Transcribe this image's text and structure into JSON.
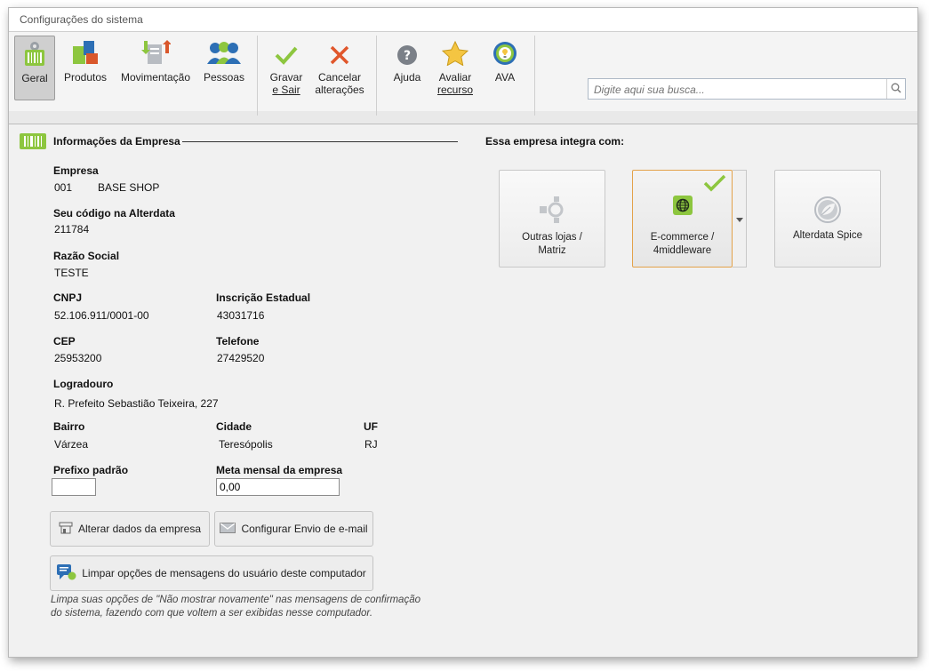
{
  "window": {
    "title": "Configurações do sistema"
  },
  "ribbon": {
    "buttons": [
      {
        "label": "Geral",
        "icon": "barcode-gear-icon",
        "active": true
      },
      {
        "label": "Produtos",
        "icon": "products-icon"
      },
      {
        "label": "Movimentação",
        "icon": "movement-icon"
      },
      {
        "label": "Pessoas",
        "icon": "people-icon"
      },
      {
        "label_line1": "Gravar",
        "label_line2": "e Sair",
        "icon": "check-icon"
      },
      {
        "label_line1": "Cancelar",
        "label_line2": "alterações",
        "icon": "x-icon"
      },
      {
        "label": "Ajuda",
        "icon": "help-icon"
      },
      {
        "label_line1": "Avaliar",
        "label_line2": "recurso",
        "icon": "star-icon"
      },
      {
        "label": "AVA",
        "icon": "ava-icon"
      }
    ],
    "search": {
      "placeholder": "Digite aqui sua busca..."
    }
  },
  "company": {
    "section_title": "Informações da Empresa",
    "empresa_label": "Empresa",
    "empresa_code": "001",
    "empresa_name": "BASE SHOP",
    "codigo_label": "Seu código na Alterdata",
    "codigo_value": "211784",
    "razao_label": "Razão Social",
    "razao_value": "TESTE",
    "cnpj_label": "CNPJ",
    "cnpj_value": "52.106.911/0001-00",
    "ie_label": "Inscrição Estadual",
    "ie_value": "43031716",
    "cep_label": "CEP",
    "cep_value": "25953200",
    "telefone_label": "Telefone",
    "telefone_value": "27429520",
    "logradouro_label": "Logradouro",
    "logradouro_value": "R. Prefeito Sebastião Teixeira, 227",
    "bairro_label": "Bairro",
    "bairro_value": "Várzea",
    "cidade_label": "Cidade",
    "cidade_value": "Teresópolis",
    "uf_label": "UF",
    "uf_value": "RJ",
    "prefixo_label": "Prefixo padrão",
    "prefixo_value": "",
    "meta_label": "Meta mensal da empresa",
    "meta_value": "0,00",
    "alterar_button": "Alterar dados da empresa",
    "email_button": "Configurar Envio de e-mail",
    "limpar_button": "Limpar opções de mensagens do usuário deste computador",
    "note_line1": "Limpa suas opções de \"Não mostrar novamente\" nas mensagens de confirmação",
    "note_line2": "do sistema, fazendo com que voltem a ser exibidas nesse computador."
  },
  "integrations": {
    "title": "Essa empresa integra com:",
    "cards": [
      {
        "line1": "Outras lojas /",
        "line2": "Matriz",
        "selected": false
      },
      {
        "line1": "E-commerce /",
        "line2": "4middleware",
        "selected": true
      },
      {
        "line1": "Alterdata Spice",
        "line2": "",
        "selected": false
      }
    ]
  },
  "colors": {
    "accent_green": "#8dc63f",
    "cancel_red": "#e0562b",
    "selected_border": "#e3a24a"
  }
}
